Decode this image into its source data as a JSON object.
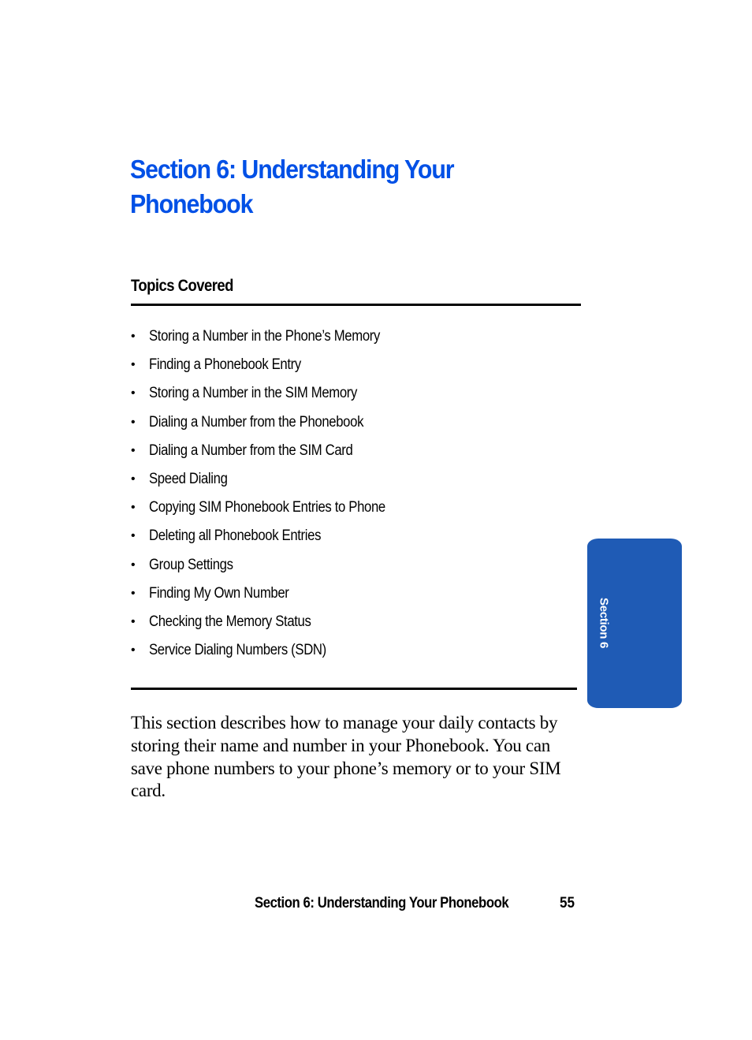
{
  "page": {
    "title": "Section 6: Understanding Your Phonebook",
    "topics_heading": "Topics Covered",
    "topics": [
      "Storing a Number in the Phone’s Memory",
      "Finding a Phonebook Entry",
      "Storing a Number in the SIM Memory",
      "Dialing a Number from the Phonebook",
      "Dialing a Number from the SIM Card",
      "Speed Dialing",
      "Copying SIM Phonebook Entries to Phone",
      "Deleting all Phonebook Entries",
      "Group Settings",
      "Finding My Own Number",
      "Checking the Memory Status",
      "Service Dialing Numbers (SDN)"
    ],
    "bullet": "•",
    "body": "This section describes how to manage your daily contacts by storing their name and number in your Phonebook. You can save phone numbers to your phone’s memory or to your SIM card."
  },
  "side_tab": {
    "label": "Section 6",
    "color": "#1f5bb5"
  },
  "footer": {
    "title": "Section 6: Understanding Your Phonebook",
    "page_number": "55"
  },
  "colors": {
    "title": "#0050e6",
    "text": "#000000"
  }
}
